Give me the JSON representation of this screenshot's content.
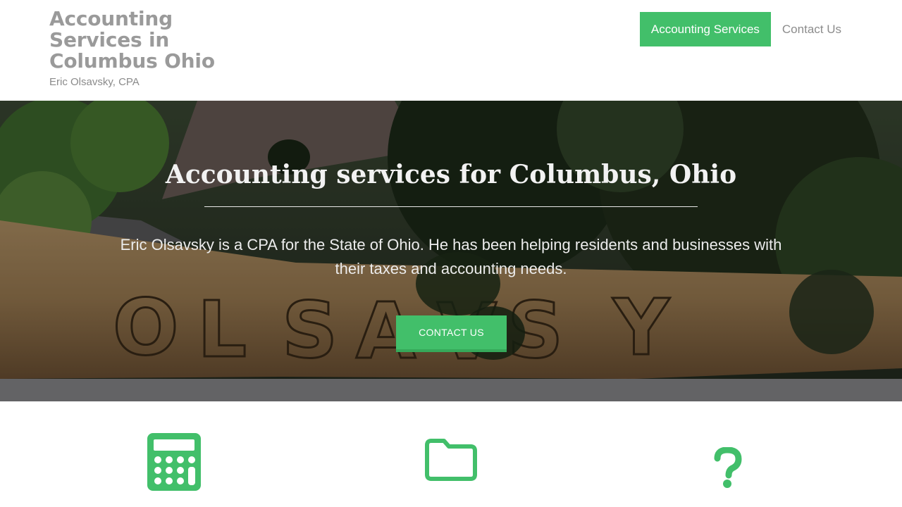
{
  "header": {
    "site_title": "Accounting Services in Columbus Ohio",
    "tagline": "Eric Olsavsky, CPA"
  },
  "nav": {
    "items": [
      {
        "label": "Accounting Services",
        "active": true
      },
      {
        "label": "Contact Us",
        "active": false
      }
    ]
  },
  "hero": {
    "title": "Accounting services for Columbus, Ohio",
    "description": "Eric Olsavsky is a CPA for the State of Ohio. He has been helping residents and businesses with their taxes and accounting needs.",
    "button_label": "Contact Us",
    "sign_text": "OLSAVSKY"
  },
  "features": {
    "icons": [
      "calculator-icon",
      "folder-icon",
      "question-icon"
    ]
  },
  "colors": {
    "accent": "#42bf6a",
    "title_gray": "#9a9a9a"
  }
}
